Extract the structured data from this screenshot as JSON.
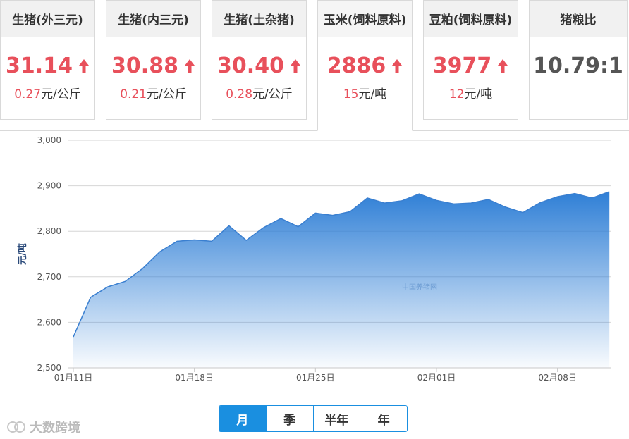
{
  "cards": [
    {
      "title": "生猪(外三元)",
      "price": "31.14",
      "change_num": "0.27",
      "change_unit": "元/公斤",
      "trend": "up"
    },
    {
      "title": "生猪(内三元)",
      "price": "30.88",
      "change_num": "0.21",
      "change_unit": "元/公斤",
      "trend": "up"
    },
    {
      "title": "生猪(土杂猪)",
      "price": "30.40",
      "change_num": "0.28",
      "change_unit": "元/公斤",
      "trend": "up"
    },
    {
      "title": "玉米(饲料原料)",
      "price": "2886",
      "change_num": "15",
      "change_unit": "元/吨",
      "trend": "up"
    },
    {
      "title": "豆粕(饲料原料)",
      "price": "3977",
      "change_num": "12",
      "change_unit": "元/吨",
      "trend": "up"
    },
    {
      "title": "猪粮比",
      "price": "10.79:1",
      "change_num": "",
      "change_unit": "",
      "trend": "none"
    }
  ],
  "active_card_index": 3,
  "colors": {
    "up": "#e8505b",
    "accent": "#1a8fe0",
    "area_top": "#2f7fd6",
    "line": "#3a7fd0"
  },
  "chart_data": {
    "type": "area",
    "ylabel": "元/吨",
    "ylim": [
      2500,
      3000
    ],
    "yticks": [
      "2,500",
      "2,600",
      "2,700",
      "2,800",
      "2,900",
      "3,000"
    ],
    "xtick_labels": [
      {
        "index": 0,
        "label": "01月11日"
      },
      {
        "index": 7,
        "label": "01月18日"
      },
      {
        "index": 14,
        "label": "01月25日"
      },
      {
        "index": 21,
        "label": "02月01日"
      },
      {
        "index": 28,
        "label": "02月08日"
      }
    ],
    "watermark": "中国养猪网",
    "values": [
      2568,
      2655,
      2678,
      2690,
      2718,
      2755,
      2778,
      2781,
      2778,
      2812,
      2780,
      2808,
      2828,
      2810,
      2840,
      2835,
      2843,
      2873,
      2862,
      2867,
      2882,
      2868,
      2860,
      2862,
      2870,
      2853,
      2841,
      2863,
      2876,
      2883,
      2873,
      2887
    ],
    "grid": true
  },
  "periods": [
    "月",
    "季",
    "半年",
    "年"
  ],
  "active_period": 0,
  "brand": "大数跨境"
}
